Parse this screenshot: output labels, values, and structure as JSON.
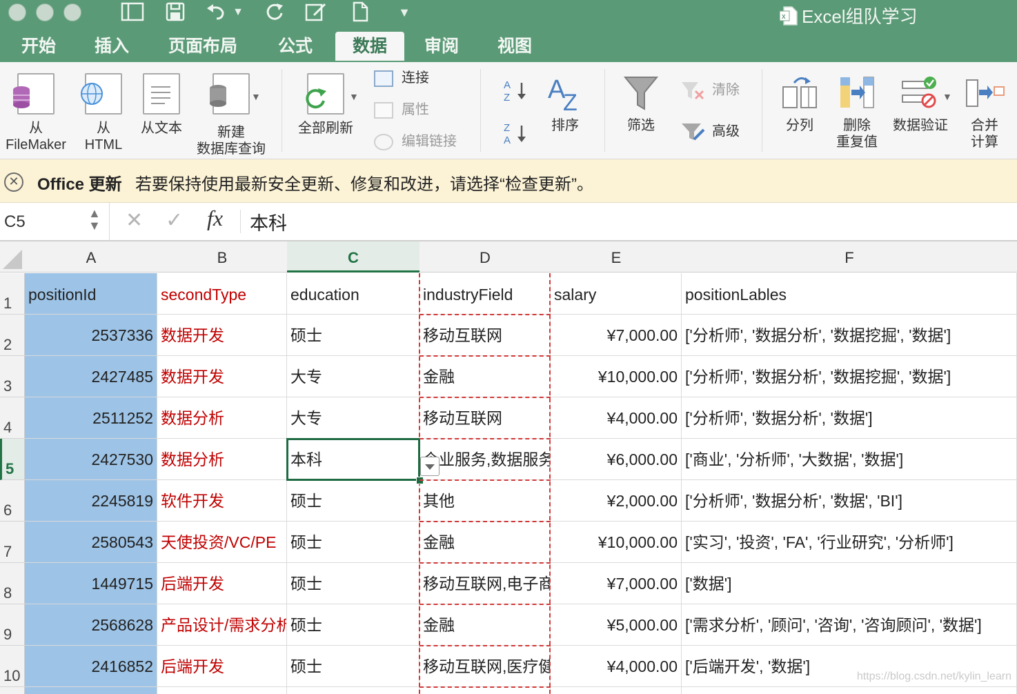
{
  "window": {
    "title": "Excel组队学习"
  },
  "tabs": [
    "开始",
    "插入",
    "页面布局",
    "公式",
    "数据",
    "审阅",
    "视图"
  ],
  "active_tab": "数据",
  "ribbon": {
    "from_filemaker": [
      "从",
      "FileMaker"
    ],
    "from_html": [
      "从",
      "HTML"
    ],
    "from_text": "从文本",
    "new_db_query": [
      "新建",
      "数据库查询"
    ],
    "refresh_all": "全部刷新",
    "connections": "连接",
    "properties": "属性",
    "edit_links": "编辑链接",
    "sort": "排序",
    "filter": "筛选",
    "clear": "清除",
    "advanced": "高级",
    "text_to_columns": "分列",
    "remove_duplicates": [
      "删除",
      "重复值"
    ],
    "data_validation": "数据验证",
    "consolidate": [
      "合并",
      "计算"
    ]
  },
  "message_bar": {
    "title": "Office 更新",
    "text": "若要保持使用最新安全更新、修复和改进，请选择“检查更新”。"
  },
  "formula_bar": {
    "name_box": "C5",
    "fx": "fx",
    "value": "本科"
  },
  "columns": [
    "A",
    "B",
    "C",
    "D",
    "E",
    "F"
  ],
  "selected_column": "C",
  "row_numbers": [
    "1",
    "2",
    "3",
    "4",
    "5",
    "6",
    "7",
    "8",
    "9",
    "10"
  ],
  "selected_row": "5",
  "header_row": [
    "positionId",
    "secondType",
    "education",
    "industryField",
    "salary",
    "positionLables"
  ],
  "rows": [
    [
      "2537336",
      "数据开发",
      "硕士",
      "移动互联网",
      "¥7,000.00",
      "['分析师', '数据分析', '数据挖掘', '数据']"
    ],
    [
      "2427485",
      "数据开发",
      "大专",
      "金融",
      "¥10,000.00",
      "['分析师', '数据分析', '数据挖掘', '数据']"
    ],
    [
      "2511252",
      "数据分析",
      "大专",
      "移动互联网",
      "¥4,000.00",
      "['分析师', '数据分析', '数据']"
    ],
    [
      "2427530",
      "数据分析",
      "本科",
      "企业服务,数据服务",
      "¥6,000.00",
      "['商业', '分析师', '大数据', '数据']"
    ],
    [
      "2245819",
      "软件开发",
      "硕士",
      "其他",
      "¥2,000.00",
      "['分析师', '数据分析', '数据', 'BI']"
    ],
    [
      "2580543",
      "天使投资/VC/PE",
      "硕士",
      "金融",
      "¥10,000.00",
      "['实习', '投资', 'FA', '行业研究', '分析师']"
    ],
    [
      "1449715",
      "后端开发",
      "硕士",
      "移动互联网,电子商务",
      "¥7,000.00",
      "['数据']"
    ],
    [
      "2568628",
      "产品设计/需求分析",
      "硕士",
      "金融",
      "¥5,000.00",
      "['需求分析', '顾问', '咨询', '咨询顾问', '数据']"
    ],
    [
      "2416852",
      "后端开发",
      "硕士",
      "移动互联网,医疗健康",
      "¥4,000.00",
      "['后端开发', '数据']"
    ]
  ],
  "watermark": "https://blog.csdn.net/kylin_learn",
  "colors": {
    "ribbon_green": "#5b9a77",
    "excel_green": "#217346",
    "selection_blue": "#9dc3e6",
    "red_text": "#c00000",
    "marquee_red": "#d03838",
    "message_bg": "#fcf3d6"
  }
}
